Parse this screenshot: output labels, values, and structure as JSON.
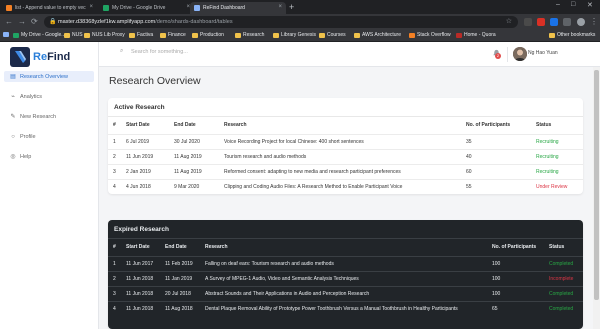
{
  "browser": {
    "tabs": [
      {
        "title": "list - Append value to empty vec"
      },
      {
        "title": "My Drive - Google Drive"
      },
      {
        "title": "ReFind Dashboard"
      }
    ],
    "url_host": "master.d38368yzlef1kw.amplifyapp.com",
    "url_path": "/demo/shards-dashboard/tables",
    "bookmarks": [
      {
        "label": "My Drive - Google..."
      },
      {
        "label": "NUS"
      },
      {
        "label": "NUS Lib Proxy"
      },
      {
        "label": "Factiva"
      },
      {
        "label": "Finance"
      },
      {
        "label": "Production"
      },
      {
        "label": "Research"
      },
      {
        "label": "Library Genesis"
      },
      {
        "label": "Courses"
      },
      {
        "label": "AWS Architecture"
      },
      {
        "label": "Stack Overflow"
      },
      {
        "label": "Home - Quora"
      },
      {
        "label": "Other bookmarks"
      }
    ]
  },
  "app": {
    "logo": {
      "re": "Re",
      "find": "Find"
    },
    "nav": [
      {
        "label": "Research Overview"
      },
      {
        "label": "Analytics"
      },
      {
        "label": "New Research"
      },
      {
        "label": "Profile"
      },
      {
        "label": "Help"
      }
    ],
    "search_placeholder": "Search for something...",
    "notification_count": "2",
    "username": "Ng Hao Yuan",
    "page_title": "Research Overview"
  },
  "active": {
    "title": "Active Research",
    "columns": [
      "#",
      "Start Date",
      "End Date",
      "Research",
      "No. of Participants",
      "Status"
    ],
    "rows": [
      {
        "n": "1",
        "start": "6 Jul 2019",
        "end": "30 Jul 2020",
        "research": "Voice Recording Project for local Chinese: 400 short sentences",
        "participants": "35",
        "status": "Recruiting"
      },
      {
        "n": "2",
        "start": "11 Jun 2019",
        "end": "11 Aug 2019",
        "research": "Tourism research and audio methods",
        "participants": "40",
        "status": "Recruiting"
      },
      {
        "n": "3",
        "start": "2 Jan 2019",
        "end": "11 Aug 2019",
        "research": "Reformed consent: adapting to new media and research participant preferences",
        "participants": "60",
        "status": "Recruiting"
      },
      {
        "n": "4",
        "start": "4 Jun 2018",
        "end": "9 Mar 2020",
        "research": "Clipping and Coding Audio Files: A Research Method to Enable Participant Voice",
        "participants": "55",
        "status": "Under Review"
      }
    ]
  },
  "expired": {
    "title": "Expired Research",
    "columns": [
      "#",
      "Start Date",
      "End Date",
      "Research",
      "No. of Participants",
      "Status"
    ],
    "rows": [
      {
        "n": "1",
        "start": "11 Jun 2017",
        "end": "11 Feb 2019",
        "research": "Falling on deaf ears: Tourism research and audio methods",
        "participants": "100",
        "status": "Completed"
      },
      {
        "n": "2",
        "start": "11 Jun 2018",
        "end": "11 Jan 2019",
        "research": "A Survey of MPEG-1 Audio, Video and Semantic Analysis Techniques",
        "participants": "100",
        "status": "Incomplete"
      },
      {
        "n": "3",
        "start": "11 Jun 2018",
        "end": "20 Jul 2018",
        "research": "Abstract Sounds and Their Applications in Audio and Perception Research",
        "participants": "100",
        "status": "Completed"
      },
      {
        "n": "4",
        "start": "11 Jun 2018",
        "end": "11 Aug 2018",
        "research": "Dental Plaque Removal Ability of Prototype Power Toothbrush Versus a Manual Toothbrush in Healthy Participants",
        "participants": "65",
        "status": "Completed"
      }
    ]
  },
  "colors": {
    "accent": "#2b6fc9",
    "recruiting": "#28a745",
    "review": "#dc3545"
  }
}
